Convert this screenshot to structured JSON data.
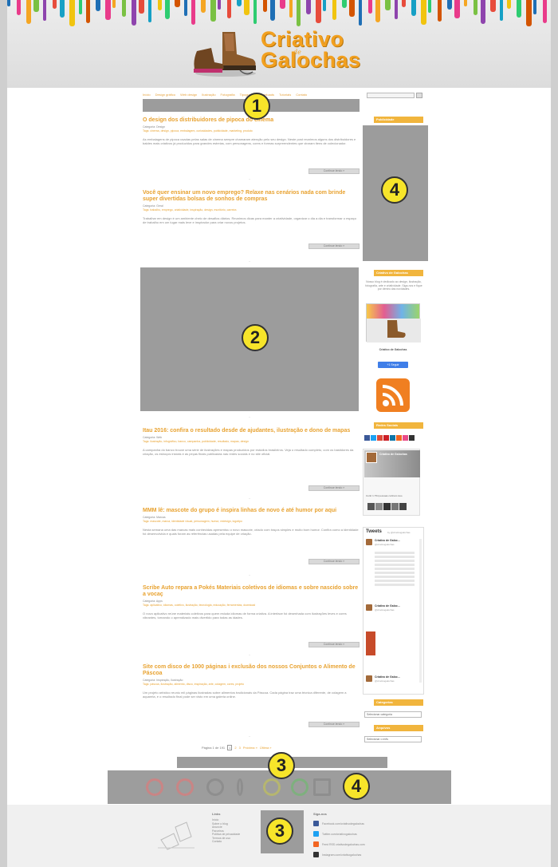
{
  "header": {
    "logo_line1": "Criativo",
    "logo_small": "de",
    "logo_line2": "Galochas",
    "drip_colors": [
      "#1f6fb5",
      "#e93b8a",
      "#f5a623",
      "#7ac143",
      "#8e44ad",
      "#e74c3c",
      "#16a0c5",
      "#f1c40f",
      "#2ecc71",
      "#d35400"
    ]
  },
  "nav": {
    "links": [
      "Início",
      "Design gráfico",
      "Web design",
      "Ilustração",
      "Fotografia",
      "Tipografia",
      "Downloads",
      "Tutoriais",
      "Contato"
    ]
  },
  "markers": [
    "1",
    "2",
    "3",
    "4",
    "4",
    "3",
    "3"
  ],
  "posts": [
    {
      "title": "O design dos distribuidores de pipoca do cinema",
      "meta1": "Categoria: Design",
      "meta2": "Tags: cinema, design, pipoca, embalagem, curiosidades, publicidade, marketing, produto",
      "excerpt": "As embalagens de pipoca usadas pelas salas de cinema sempre chamaram atenção pelo seu design. Neste post reunimos alguns dos distribuidores e baldes mais criativos já produzidos para grandes estreias, com personagens, cores e formas surpreendentes que viraram itens de colecionador.",
      "more": "Continue lendo »"
    },
    {
      "title": "Você quer ensinar um novo emprego? Relaxe nas cenários nada com brinde super divertidas bolsas de sonhos de compras",
      "meta1": "Categoria: Geral",
      "meta2": "Tags: trabalho, emprego, criatividade, inspiração, design, escritório, carreira",
      "excerpt": "Trabalhar em design é um ambiente cheio de desafios diários. Reunimos dicas para manter a criatividade, organizar o dia a dia e transformar o espaço de trabalho em um lugar mais leve e inspirador para criar novos projetos.",
      "more": "Continue lendo »"
    },
    {
      "title": "Itau 2016: confira o resultado desde de ajudantes, ilustração e dono de mapas",
      "meta1": "Categoria: Web",
      "meta2": "Tags: ilustração, infográfico, banco, campanha, publicidade, resultado, mapas, design",
      "excerpt": "A campanha do banco trouxe uma série de ilustrações e mapas produzidos por estúdios brasileiros. Veja o resultado completo, com os bastidores da criação, os esboços iniciais e as peças finais publicadas nas redes sociais e no site oficial.",
      "more": "Continue lendo »"
    },
    {
      "title": "MMM lê: mascote do grupo é inspira linhas de novo é até humor por aqui",
      "meta1": "Categoria: Marcas",
      "meta2": "Tags: mascote, marca, identidade visual, personagem, humor, redesign, logotipo",
      "excerpt": "Nesta semana uma das marcas mais conhecidas apresentou o novo mascote, criado com traços simples e muito bom humor. Confira como a identidade foi desenvolvida e quais foram as referências usadas pela equipe de criação.",
      "more": "Continue lendo »"
    },
    {
      "title": "Scribe Auto repara a Pokés Materiais coletivos de idiomas e sobre nascido sobre a vocaç",
      "meta1": "Categoria: Apps",
      "meta2": "Tags: aplicativo, idiomas, coletivo, ilustração, tecnologia, educação, ferramentas, download",
      "excerpt": "O novo aplicativo reúne materiais coletivos para quem estuda idiomas de forma criativa. A interface foi desenhada com ilustrações leves e cores vibrantes, tornando o aprendizado mais divertido para todas as idades.",
      "more": "Continue lendo »"
    },
    {
      "title": "Site com disco de 1000 páginas i exclusão dos nossos Conjuntos o Alimento de Páscoa",
      "meta1": "Categoria: Inspiração, Ilustração",
      "meta2": "Tags: páscoa, ilustração, alimento, disco, inspiração, arte, colagem, cores, projeto",
      "excerpt": "Um projeto artístico reuniu mil páginas ilustradas sobre alimentos tradicionais da Páscoa. Cada página traz uma técnica diferente, de colagem a aquarela, e o resultado final pode ser visto em uma galeria online.",
      "more": "Continue lendo »"
    }
  ],
  "pagination": {
    "label": "Página 1 de 191",
    "num1": "1",
    "num2": "2",
    "num3": "3",
    "next": "Próxima »",
    "last": "Última »"
  },
  "sidebar": {
    "head1": "Publicidade",
    "head2": "Criativo de Galochas",
    "about_text": "Nosso blog é dedicado ao design, ilustração, fotografia, arte e criatividade. Siga-nos e fique por dentro das novidades.",
    "profile_name": "Criativo de Galochas",
    "follow_button": "+1 Seguir",
    "head3": "Redes Sociais",
    "fb_page_name": "Criativo de Galochas",
    "fb_likes": "Curtir  1.754 pessoas curtiram isso",
    "tweets_title": "Tweets",
    "tweets_by": "by @criativogalochas",
    "tweet_name": "Criativo de Galoc...",
    "tweet_handle": "@criativogalochas",
    "head4": "Categorias",
    "select1": "Selecionar categoria",
    "head5": "Arquivos",
    "select2": "Selecionar o mês"
  },
  "footer": {
    "col1_title": "Links",
    "col1_links": [
      "Início",
      "Sobre o blog",
      "Anuncie",
      "Parceiros",
      "Política de privacidade",
      "Termos de uso",
      "Contato"
    ],
    "col3_title": "Siga-nos",
    "social": [
      {
        "label": "Facebook.com/criativodegalochas",
        "color": "#3b5998"
      },
      {
        "label": "Twitter.com/criativogalochas",
        "color": "#1da1f2"
      },
      {
        "label": "Feed RSS criativodegalochas.com",
        "color": "#f26522"
      },
      {
        "label": "Instagram.com/criativogalochas",
        "color": "#333333"
      }
    ]
  }
}
